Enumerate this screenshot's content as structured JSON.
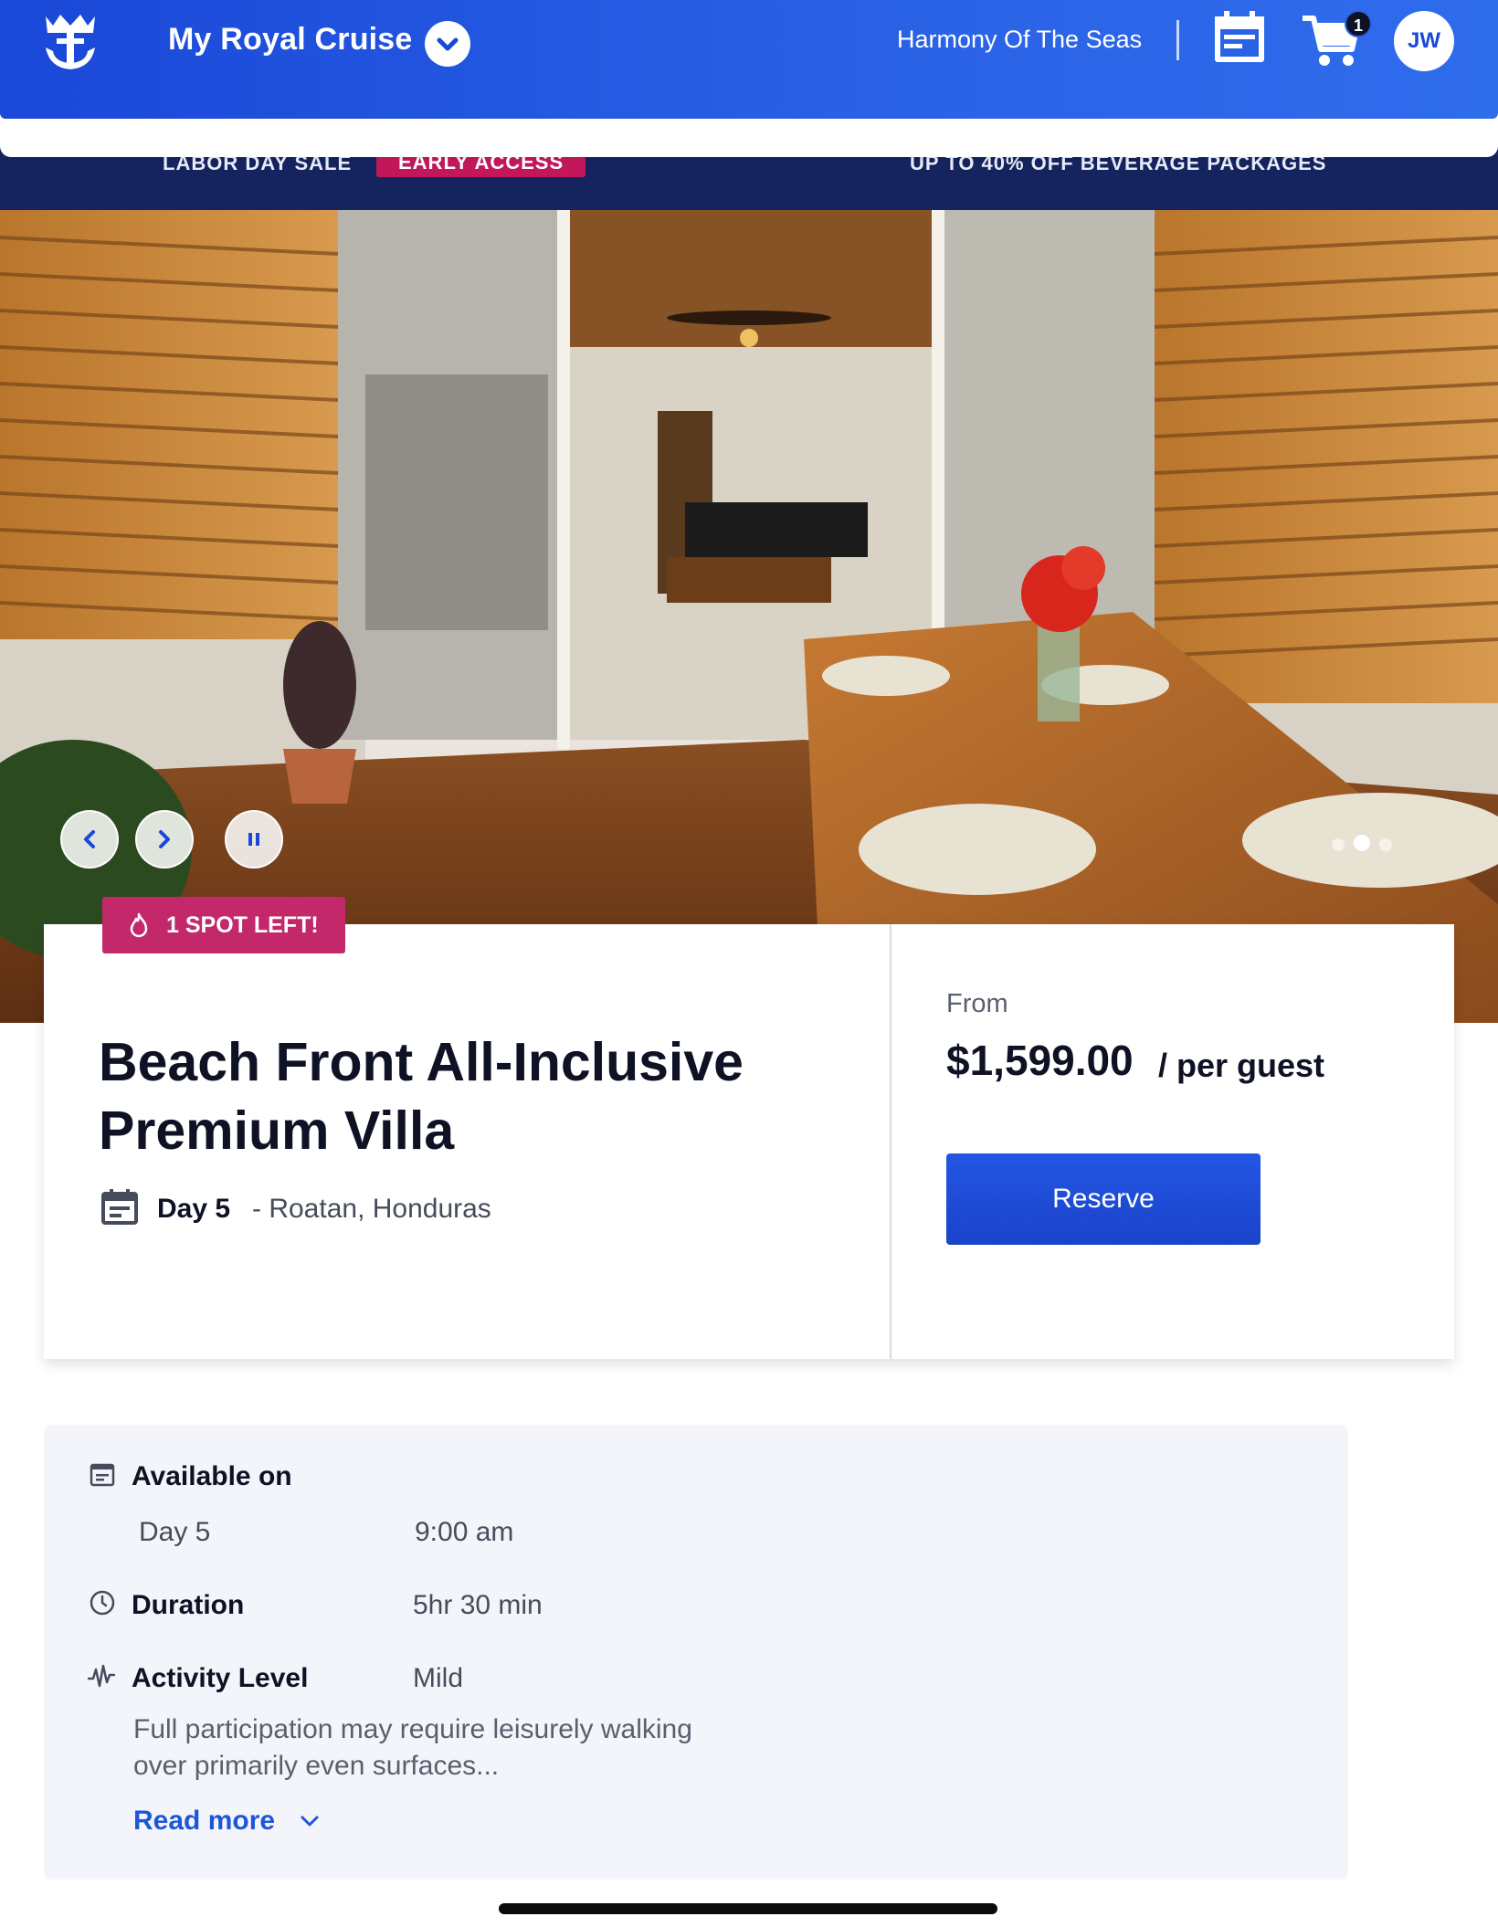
{
  "header": {
    "app_title": "My Royal Cruise",
    "ship_name": "Harmony Of The Seas",
    "cart_count": "1",
    "avatar_initials": "JW",
    "icons": [
      "royal-caribbean-crown-anchor-icon",
      "chevron-down-icon",
      "planner-icon",
      "cart-icon"
    ]
  },
  "promo": {
    "left_text": "LABOR DAY SALE",
    "tag": "EARLY ACCESS",
    "right_text": "UP TO 40% OFF BEVERAGE PACKAGES"
  },
  "hero": {
    "controls": [
      "previous-slide",
      "next-slide",
      "pause-slideshow"
    ],
    "slide_count": 3,
    "active_slide": 2
  },
  "badge": {
    "text": "1 SPOT LEFT!"
  },
  "excursion": {
    "title_line1": "Beach Front All-Inclusive",
    "title_line2": "Premium Villa",
    "day": "Day 5",
    "port": "- Roatan, Honduras"
  },
  "pricing": {
    "from_label": "From",
    "price": "$1,599.00",
    "unit": "/ per guest",
    "reserve_label": "Reserve"
  },
  "details": {
    "available_label": "Available on",
    "available_day": "Day 5",
    "available_time": "9:00 am",
    "duration_label": "Duration",
    "duration_value": "5hr 30 min",
    "activity_label": "Activity Level",
    "activity_value": "Mild",
    "activity_desc_line1": "Full participation may require leisurely walking",
    "activity_desc_line2": "over primarily even surfaces...",
    "read_more_label": "Read more"
  },
  "colors": {
    "brand_blue": "#1a48d8",
    "promo_navy": "#15235f",
    "badge_pink": "#c2286a",
    "link_blue": "#1f56d8"
  }
}
